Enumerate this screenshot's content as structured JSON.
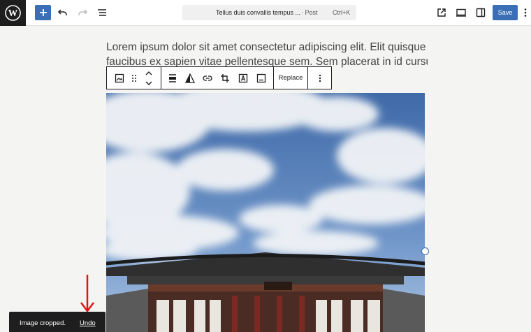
{
  "topbar": {
    "document_title": "Tellus duis convallis tempus ...",
    "document_type": "· Post",
    "shortcut": "Ctrl+K",
    "save_label": "Save",
    "accent_color": "#3a6fb5",
    "icons": [
      "wordpress-logo-icon",
      "add-block-icon",
      "undo-icon",
      "redo-icon",
      "document-overview-icon",
      "view-post-icon",
      "preview-icon",
      "settings-sidebar-icon",
      "options-icon"
    ]
  },
  "content": {
    "paragraph_line1": "Lorem ipsum dolor sit amet consectetur adipiscing elit. Elit quisque",
    "paragraph_line2": "faucibus ex sapien vitae pellentesque sem. Sem placerat in id cursus"
  },
  "block_toolbar": {
    "replace_label": "Replace",
    "icons": [
      "image-block-icon",
      "drag-handle-icon",
      "move-up-icon",
      "move-down-icon",
      "align-icon",
      "duotone-icon",
      "link-icon",
      "crop-icon",
      "text-overlay-icon",
      "caption-icon",
      "more-options-icon"
    ]
  },
  "snackbar": {
    "message": "Image cropped.",
    "action_label": "Undo"
  }
}
